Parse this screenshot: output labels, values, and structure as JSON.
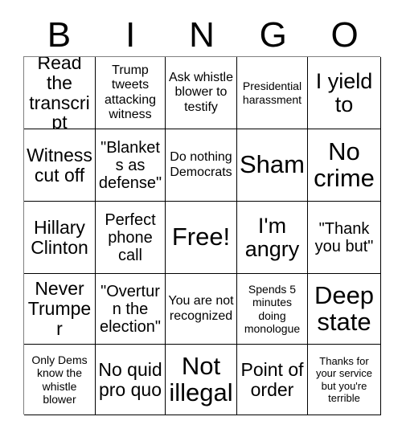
{
  "card": {
    "header_letters": [
      "B",
      "I",
      "N",
      "G",
      "O"
    ],
    "columns": 5,
    "rows": 5,
    "free_space_label": "Free!",
    "free_space_index": 12,
    "border_color": "#000000",
    "text_color": "#000000",
    "background_color": "#ffffff",
    "cells": [
      {
        "text": "Read the transcript",
        "size": "lg"
      },
      {
        "text": "Trump tweets attacking witness",
        "size": "sm"
      },
      {
        "text": "Ask whistle blower to testify",
        "size": "sm"
      },
      {
        "text": "Presidential harassment",
        "size": "xs"
      },
      {
        "text": "I yield to",
        "size": "xl"
      },
      {
        "text": "Witness cut off",
        "size": "lg"
      },
      {
        "text": "\"Blankets as defense\"",
        "size": "md"
      },
      {
        "text": "Do nothing Democrats",
        "size": "sm"
      },
      {
        "text": "Sham",
        "size": "xxl"
      },
      {
        "text": "No crime",
        "size": "xxl"
      },
      {
        "text": "Hillary Clinton",
        "size": "lg"
      },
      {
        "text": "Perfect phone call",
        "size": "md"
      },
      {
        "text": "Free!",
        "size": "xxl"
      },
      {
        "text": "I'm angry",
        "size": "xl"
      },
      {
        "text": "\"Thank you but\"",
        "size": "md"
      },
      {
        "text": "Never Trumper",
        "size": "lg"
      },
      {
        "text": "\"Overturn the election\"",
        "size": "md"
      },
      {
        "text": "You are not recognized",
        "size": "sm"
      },
      {
        "text": "Spends 5 minutes doing monologue",
        "size": "xs"
      },
      {
        "text": "Deep state",
        "size": "xxl"
      },
      {
        "text": "Only Dems know the whistle blower",
        "size": "xs"
      },
      {
        "text": "No quid pro quo",
        "size": "lg"
      },
      {
        "text": "Not illegal",
        "size": "xxl"
      },
      {
        "text": "Point of order",
        "size": "lg"
      },
      {
        "text": "Thanks for your service but you're terrible",
        "size": "xxs"
      }
    ]
  }
}
